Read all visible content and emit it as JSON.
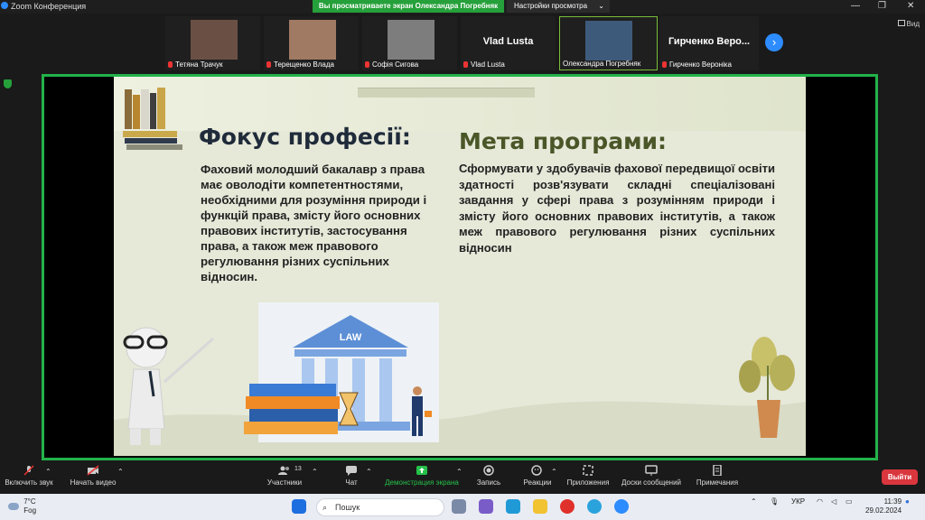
{
  "app": {
    "title": "Zoom Конференция"
  },
  "share_banner": "Вы просматриваете экран Олександра Погребняк",
  "view_options": {
    "label": "Настройки просмотра"
  },
  "view_button": "Вид",
  "participants": [
    {
      "name": "Тетяна Трачук",
      "video": true
    },
    {
      "name": "Терещенко Влада",
      "video": true
    },
    {
      "name": "Софія Сигова",
      "video": true
    },
    {
      "name": "Vlad Lusta",
      "video": false,
      "big_name": "Vlad Lusta"
    },
    {
      "name": "Олександра Погребняк",
      "video": true,
      "active": true
    },
    {
      "name": "Гирченко Вероніка",
      "video": false,
      "big_name": "Гирченко Веро..."
    }
  ],
  "slide": {
    "heading_left": "Фокус професії:",
    "body_left": "Фаховий молодший бакалавр з права має оволодіти компетентностями, необхідними для розуміння природи і функцій права, змісту його основних правових інститутів, застосування права, а також меж правового регулювання різних суспільних відносин.",
    "heading_right": "Мета програми:",
    "body_right": "Сформувати у здобувачів фахової передвищої освіти здатності розв'язувати складні спеціалізовані завдання у сфері права з розумінням природи і змісту його основних правових інститутів, а також меж правового регулювання різних суспільних відносин",
    "law_label": "LAW"
  },
  "toolbar": {
    "audio": "Включить звук",
    "video": "Начать видео",
    "participants": "Участники",
    "participants_count": "13",
    "chat": "Чат",
    "share": "Демонстрация экрана",
    "record": "Запись",
    "reactions": "Реакции",
    "apps": "Приложения",
    "whiteboards": "Доски сообщений",
    "notes": "Примечания",
    "leave": "Выйти"
  },
  "taskbar": {
    "weather_temp": "7°C",
    "weather_desc": "Fog",
    "search_placeholder": "Пошук",
    "lang": "УКР",
    "time": "11:39",
    "date": "29.02.2024"
  },
  "colors": {
    "share_green": "#25a03a",
    "zoom_blue": "#2d8cff",
    "leave_red": "#d9363e"
  }
}
